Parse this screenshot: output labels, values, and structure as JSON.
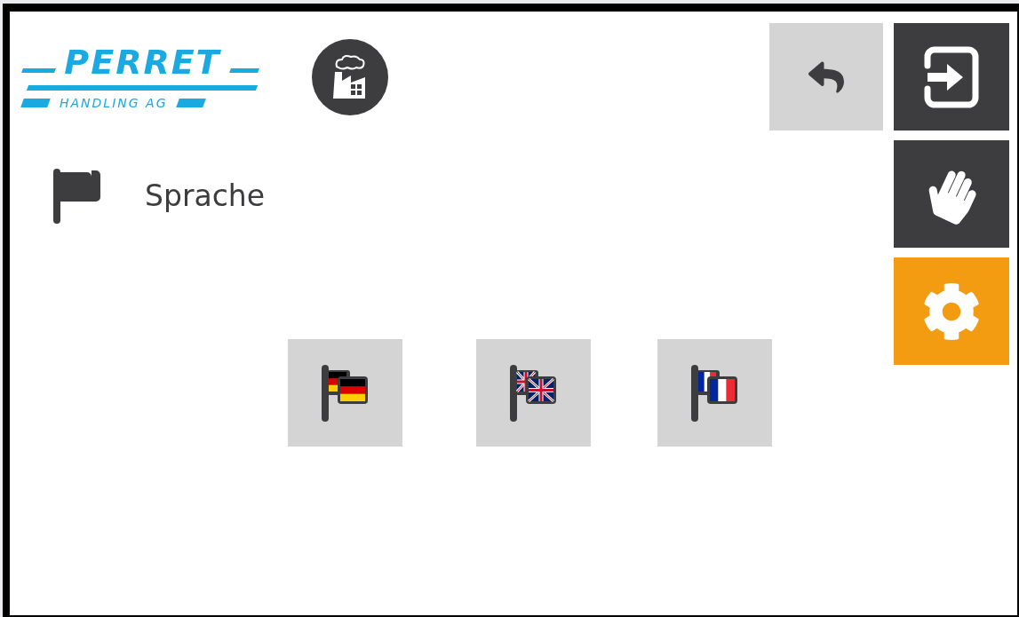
{
  "header": {
    "logo": {
      "name": "PERRET",
      "subtitle": "HANDLING AG"
    }
  },
  "section": {
    "title": "Sprache"
  },
  "languages": [
    {
      "kind": "de"
    },
    {
      "kind": "en"
    },
    {
      "kind": "fr"
    }
  ],
  "side_nav": [
    {
      "kind": "login",
      "selected": false
    },
    {
      "kind": "manual",
      "selected": false
    },
    {
      "kind": "settings",
      "selected": true
    }
  ]
}
